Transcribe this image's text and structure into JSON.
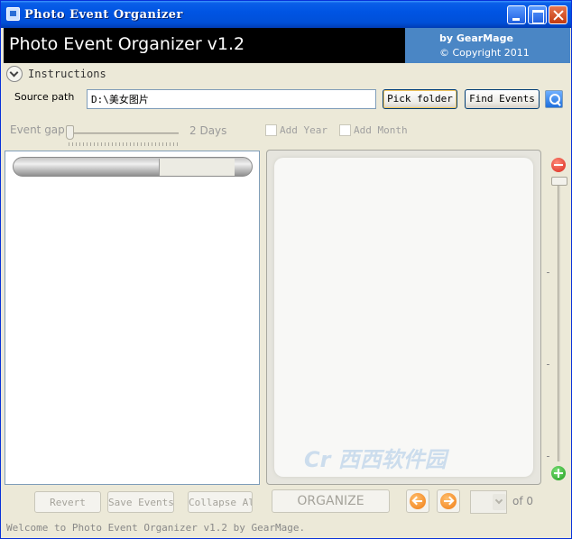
{
  "window": {
    "title": "Photo Event Organizer"
  },
  "banner": {
    "title": "Photo Event Organizer v1.2",
    "by": "by GearMage",
    "copyright": "© Copyright 2011"
  },
  "instructions": {
    "label": "Instructions"
  },
  "source": {
    "label": "Source path",
    "value": "D:\\美女图片",
    "pick_label": "Pick folder",
    "find_label": "Find Events"
  },
  "event_gap": {
    "label": "Event gap",
    "value_text": "2 Days"
  },
  "options": {
    "add_year": "Add Year",
    "add_month": "Add Month"
  },
  "bottom": {
    "revert": "Revert",
    "save": "Save Events",
    "collapse": "Collapse Al",
    "organize": "ORGANIZE",
    "page_of": "of 0"
  },
  "status": {
    "text": "Welcome to Photo Event Organizer v1.2 by GearMage."
  },
  "watermark": {
    "text": "Cr 西西软件园"
  },
  "colors": {
    "banner_bg": "#000000",
    "banner_accent": "#4a86c5",
    "titlebar": "#0054e3"
  }
}
